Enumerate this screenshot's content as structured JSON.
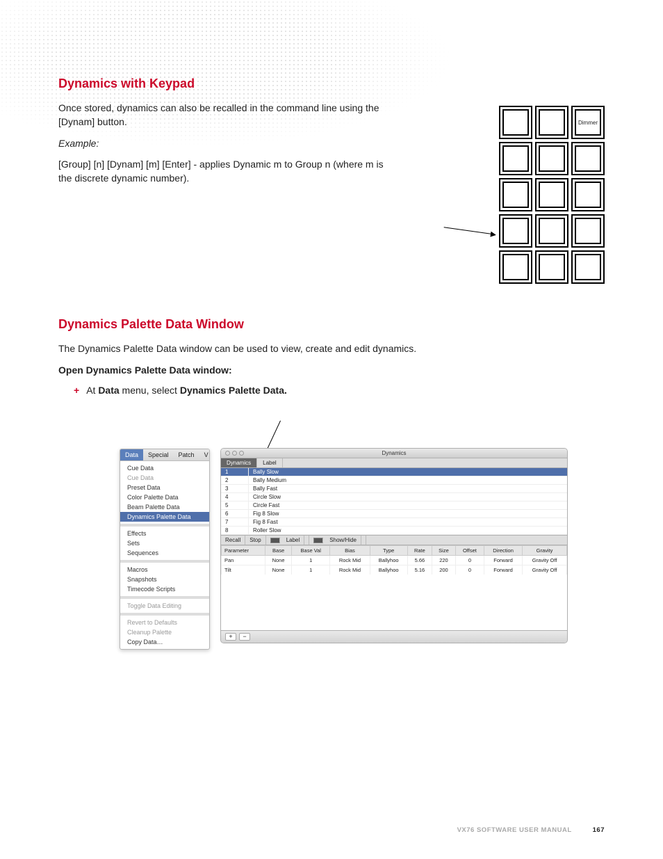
{
  "section1": {
    "heading": "Dynamics with Keypad",
    "para1": "Once stored, dynamics can also be recalled in the command line using the [Dynam] button.",
    "example_label": "Example:",
    "para2": "[Group] [n] [Dynam] [m] [Enter] - applies Dynamic m to Group n (where m is the discrete dynamic number)."
  },
  "keypad": {
    "top_right_label": "Dimmer"
  },
  "section2": {
    "heading": "Dynamics Palette Data Window",
    "intro": "The Dynamics Palette Data window can be used to view, create and edit dynamics.",
    "subhead": "Open Dynamics Palette Data window:",
    "bullet_prefix": "At ",
    "bullet_bold1": "Data",
    "bullet_mid": " menu, select ",
    "bullet_bold2": "Dynamics Palette Data.",
    "plus": "+"
  },
  "menu": {
    "tabs": [
      "Data",
      "Special",
      "Patch",
      "V"
    ],
    "items_group1": [
      "Cue Data",
      "Cue Data",
      "Preset Data",
      "Color Palette Data",
      "Beam Palette Data",
      "Dynamics Palette Data"
    ],
    "items_group2": [
      "Effects",
      "Sets",
      "Sequences"
    ],
    "items_group3": [
      "Macros",
      "Snapshots",
      "Timecode Scripts"
    ],
    "items_group4": [
      "Toggle Data Editing"
    ],
    "items_group5": [
      "Revert to Defaults",
      "Cleanup Palette",
      "Copy Data…"
    ]
  },
  "dynwin": {
    "title": "Dynamics",
    "tabs": {
      "a": "Dynamics",
      "b": "Label"
    },
    "list": [
      {
        "n": "1",
        "label": "Bally Slow"
      },
      {
        "n": "2",
        "label": "Bally Medium"
      },
      {
        "n": "3",
        "label": "Bally Fast"
      },
      {
        "n": "4",
        "label": "Circle Slow"
      },
      {
        "n": "5",
        "label": "Circle Fast"
      },
      {
        "n": "6",
        "label": "Fig 8 Slow"
      },
      {
        "n": "7",
        "label": "Fig 8 Fast"
      },
      {
        "n": "8",
        "label": "Roller Slow"
      }
    ],
    "subbar": {
      "recall": "Recall",
      "stop": "Stop",
      "label": "Label",
      "showhide": "Show/Hide"
    },
    "columns": [
      "Parameter",
      "Base",
      "Base Val",
      "Bias",
      "Type",
      "Rate",
      "Size",
      "Offset",
      "Direction",
      "Gravity"
    ],
    "rows": [
      {
        "Parameter": "Pan",
        "Base": "None",
        "Base Val": "1",
        "Bias": "Rock Mid",
        "Type": "Ballyhoo",
        "Rate": "5.66",
        "Size": "220",
        "Offset": "0",
        "Direction": "Forward",
        "Gravity": "Gravity Off"
      },
      {
        "Parameter": "Tilt",
        "Base": "None",
        "Base Val": "1",
        "Bias": "Rock Mid",
        "Type": "Ballyhoo",
        "Rate": "5.16",
        "Size": "200",
        "Offset": "0",
        "Direction": "Forward",
        "Gravity": "Gravity Off"
      }
    ],
    "status": {
      "plus": "+",
      "minus": "−"
    }
  },
  "footer": {
    "manual": "VX76 SOFTWARE USER MANUAL",
    "page": "167"
  }
}
